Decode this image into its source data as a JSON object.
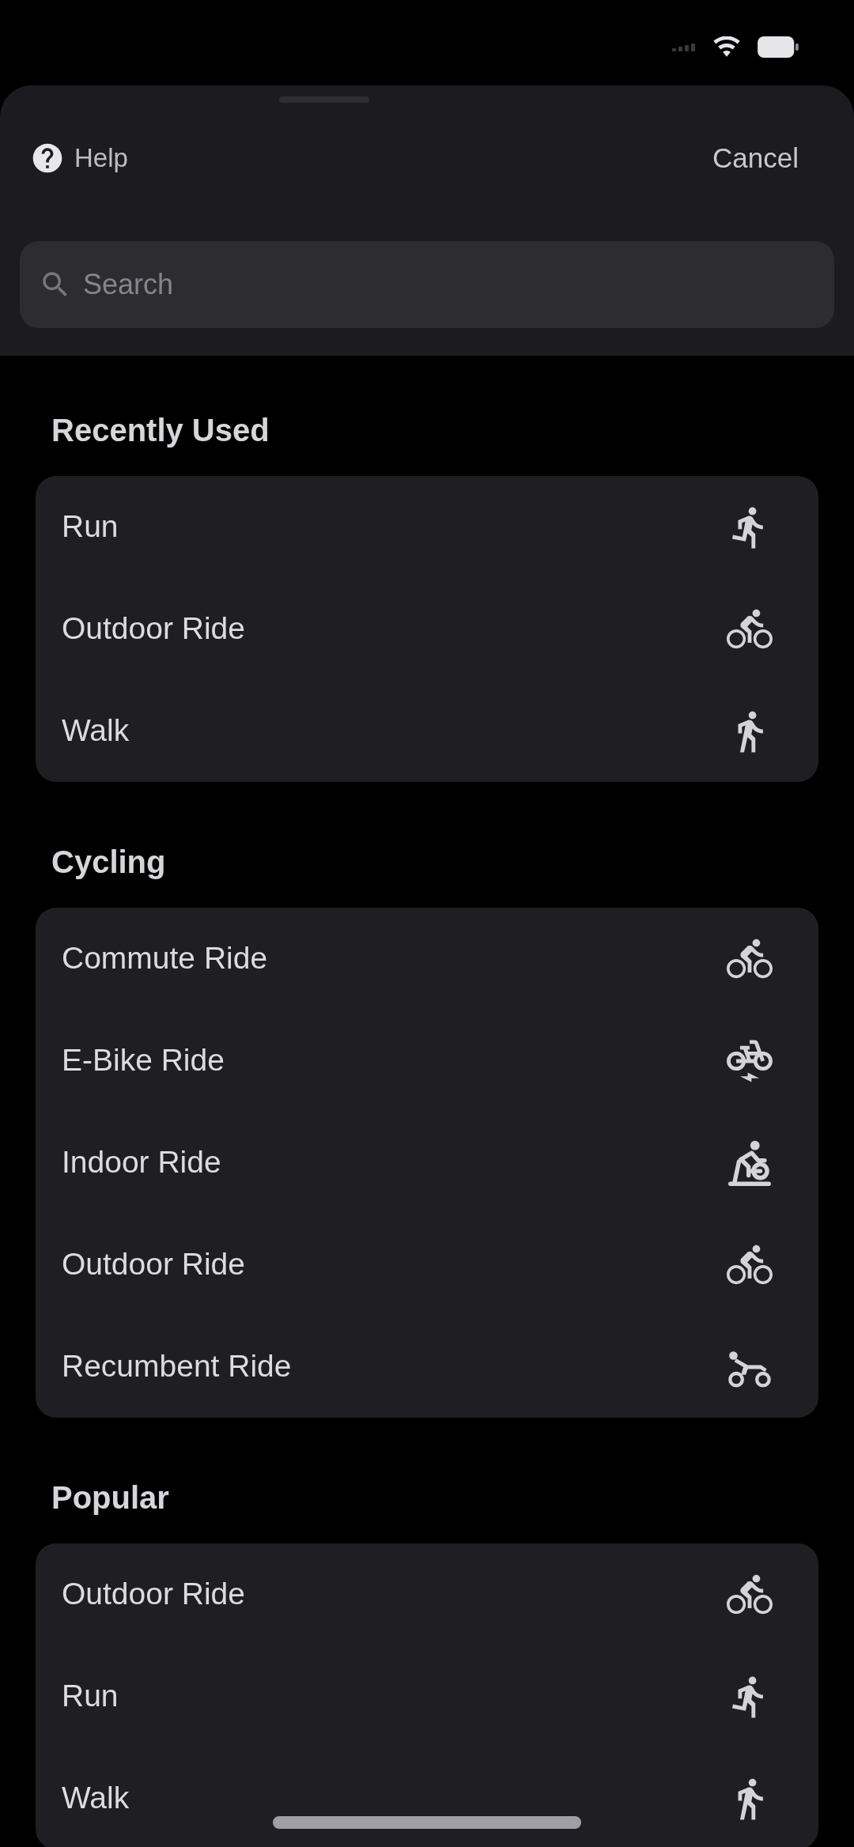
{
  "header": {
    "help_label": "Help",
    "cancel_label": "Cancel"
  },
  "search": {
    "placeholder": "Search"
  },
  "sections": [
    {
      "title": "Recently Used",
      "items": [
        {
          "label": "Run",
          "kind": "run"
        },
        {
          "label": "Outdoor Ride",
          "kind": "ride"
        },
        {
          "label": "Walk",
          "kind": "walk"
        }
      ]
    },
    {
      "title": "Cycling",
      "items": [
        {
          "label": "Commute Ride",
          "kind": "ride"
        },
        {
          "label": "E-Bike Ride",
          "kind": "ebike"
        },
        {
          "label": "Indoor Ride",
          "kind": "indoor"
        },
        {
          "label": "Outdoor Ride",
          "kind": "ride"
        },
        {
          "label": "Recumbent Ride",
          "kind": "recumbent"
        }
      ]
    },
    {
      "title": "Popular",
      "items": [
        {
          "label": "Outdoor Ride",
          "kind": "ride"
        },
        {
          "label": "Run",
          "kind": "run"
        },
        {
          "label": "Walk",
          "kind": "walk"
        }
      ]
    }
  ]
}
